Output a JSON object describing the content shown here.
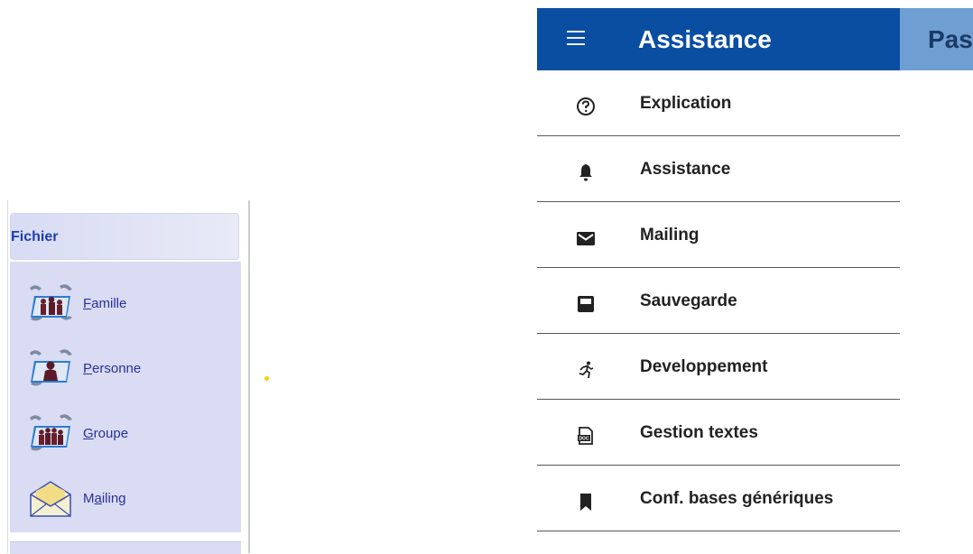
{
  "left_panel": {
    "section_title": "Fichier",
    "items": [
      {
        "label_prefix": "",
        "label_mnemonic": "F",
        "label_rest": "amille",
        "icon": "family-icon"
      },
      {
        "label_prefix": "",
        "label_mnemonic": "P",
        "label_rest": "ersonne",
        "icon": "person-icon"
      },
      {
        "label_prefix": "",
        "label_mnemonic": "G",
        "label_rest": "roupe",
        "icon": "group-icon"
      },
      {
        "label_prefix": "M",
        "label_mnemonic": "a",
        "label_rest": "iling",
        "icon": "mail-envelope-icon"
      }
    ]
  },
  "right_menu": {
    "header": {
      "title": "Assistance",
      "secondary_title": "Pas",
      "menu_icon": "hamburger-menu-icon"
    },
    "colors": {
      "header_bg": "#0a4ea2",
      "secondary_bg": "#6f9fd2"
    },
    "items": [
      {
        "label": "Explication",
        "icon": "help-circle-icon"
      },
      {
        "label": "Assistance",
        "icon": "bell-icon"
      },
      {
        "label": "Mailing",
        "icon": "mail-icon"
      },
      {
        "label": "Sauvegarde",
        "icon": "save-icon"
      },
      {
        "label": "Developpement",
        "icon": "run-icon"
      },
      {
        "label": "Gestion textes",
        "icon": "doc-icon"
      },
      {
        "label": "Conf. bases génériques",
        "icon": "bookmark-icon"
      }
    ]
  }
}
